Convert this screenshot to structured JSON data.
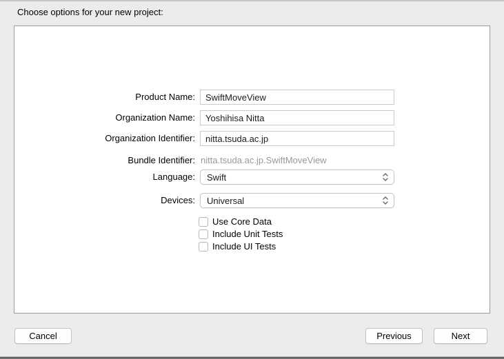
{
  "dialog": {
    "title": "Choose options for your new project:"
  },
  "fields": [
    {
      "label": "Product Name:",
      "value": "SwiftMoveView"
    },
    {
      "label": "Organization Name:",
      "value": "Yoshihisa Nitta"
    },
    {
      "label": "Organization Identifier:",
      "value": "nitta.tsuda.ac.jp"
    }
  ],
  "bundle": {
    "label": "Bundle Identifier:",
    "value": "nitta.tsuda.ac.jp.SwiftMoveView"
  },
  "popups": [
    {
      "label": "Language:",
      "value": "Swift"
    },
    {
      "label": "Devices:",
      "value": "Universal"
    }
  ],
  "checkboxes": [
    {
      "label": "Use Core Data",
      "checked": false
    },
    {
      "label": "Include Unit Tests",
      "checked": false
    },
    {
      "label": "Include UI Tests",
      "checked": false
    }
  ],
  "buttons": {
    "cancel": "Cancel",
    "previous": "Previous",
    "next": "Next"
  },
  "colors": {
    "window_bg": "#ececec",
    "panel_bg": "#ffffff",
    "panel_border": "#9b9b9b",
    "field_border": "#c9c9c9",
    "muted_text": "#98989d",
    "text": "#000000"
  }
}
